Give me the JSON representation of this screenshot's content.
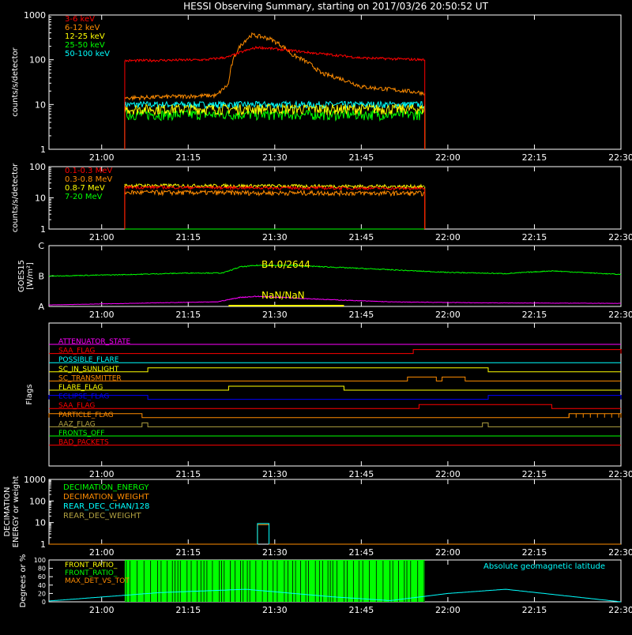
{
  "title": "HESSI Observing Summary, starting on 2017/03/26 20:50:52 UT",
  "colors": {
    "red": "#ff0000",
    "orange": "#ff8c00",
    "yellow": "#ffff00",
    "green": "#00ff00",
    "cyan": "#00ffff",
    "magenta": "#ff00ff",
    "blue": "#0000ff",
    "olive": "#b0a040",
    "white": "#ffffff"
  },
  "time_axis": {
    "tick_labels": [
      "21:00",
      "21:15",
      "21:30",
      "21:45",
      "22:00",
      "22:15",
      "22:30"
    ],
    "start": "20:50:52",
    "end": "22:30"
  },
  "chart_data": [
    {
      "id": "panel1",
      "type": "line",
      "scale": "log",
      "ylabel": "counts/s/detector",
      "yticks": [
        "1",
        "10",
        "100",
        "1000"
      ],
      "ylim": [
        1,
        1000
      ],
      "data_start": "21:04",
      "data_end": "21:56",
      "legend": [
        {
          "label": "3-6 keV",
          "color": "red"
        },
        {
          "label": "6-12 keV",
          "color": "orange"
        },
        {
          "label": "12-25 keV",
          "color": "yellow"
        },
        {
          "label": "25-50 keV",
          "color": "green"
        },
        {
          "label": "50-100 keV",
          "color": "cyan"
        }
      ],
      "series": [
        {
          "name": "3-6 keV",
          "color": "red",
          "x": [
            "21:04",
            "21:18",
            "21:22",
            "21:27",
            "21:31",
            "21:37",
            "21:45",
            "21:56"
          ],
          "values": [
            95,
            100,
            115,
            190,
            170,
            140,
            110,
            100
          ],
          "noise": 0.03
        },
        {
          "name": "6-12 keV",
          "color": "orange",
          "x": [
            "21:04",
            "21:20",
            "21:22",
            "21:24",
            "21:26",
            "21:29",
            "21:33",
            "21:38",
            "21:45",
            "21:56"
          ],
          "values": [
            14,
            16,
            28,
            200,
            360,
            300,
            130,
            50,
            25,
            18
          ],
          "noise": 0.05
        },
        {
          "name": "12-25 keV",
          "color": "yellow",
          "x": [
            "21:04",
            "21:56"
          ],
          "values": [
            8,
            8
          ],
          "noise": 0.12
        },
        {
          "name": "25-50 keV",
          "color": "green",
          "x": [
            "21:04",
            "21:56"
          ],
          "values": [
            6,
            6
          ],
          "noise": 0.12
        },
        {
          "name": "50-100 keV",
          "color": "cyan",
          "x": [
            "21:04",
            "21:56"
          ],
          "values": [
            10,
            10
          ],
          "noise": 0.08
        }
      ]
    },
    {
      "id": "panel2",
      "type": "line",
      "scale": "log",
      "ylabel": "counts/s/detector",
      "yticks": [
        "1",
        "10",
        "100"
      ],
      "ylim": [
        1,
        100
      ],
      "data_start": "21:04",
      "data_end": "21:56",
      "legend": [
        {
          "label": "0.1-0.3 MeV",
          "color": "red"
        },
        {
          "label": "0.3-0.8 MeV",
          "color": "orange"
        },
        {
          "label": "0.8-7 MeV",
          "color": "yellow"
        },
        {
          "label": "7-20 MeV",
          "color": "green"
        }
      ],
      "series": [
        {
          "name": "0.1-0.3 MeV",
          "color": "red",
          "x": [
            "21:04",
            "21:56"
          ],
          "values": [
            22,
            20
          ],
          "noise": 0.05
        },
        {
          "name": "0.3-0.8 MeV",
          "color": "orange",
          "x": [
            "21:04",
            "21:56"
          ],
          "values": [
            15,
            14
          ],
          "noise": 0.08
        },
        {
          "name": "0.8-7 MeV",
          "color": "yellow",
          "x": [
            "21:04",
            "21:56"
          ],
          "values": [
            25,
            23
          ],
          "noise": 0.06
        },
        {
          "name": "7-20 MeV",
          "color": "green",
          "x": [
            "21:04",
            "21:56"
          ],
          "values": [
            1,
            1
          ],
          "noise": 0
        }
      ]
    },
    {
      "id": "panel3",
      "type": "line",
      "ylabel": "GOES15 [W/m²]",
      "ylabel_lines": [
        "GOES15",
        "[W/m²]"
      ],
      "yticks": [
        "A",
        "B",
        "C"
      ],
      "annotations": [
        "B4.0/2644",
        "NaN/NaN"
      ],
      "series": [
        {
          "name": "long",
          "color": "green",
          "x": [
            "20:50:52",
            "21:05",
            "21:15",
            "21:21",
            "21:24",
            "21:27",
            "21:33",
            "21:45",
            "22:00",
            "22:10",
            "22:18",
            "22:25",
            "22:30"
          ],
          "values": [
            1.0,
            1.05,
            1.1,
            1.1,
            1.3,
            1.35,
            1.35,
            1.25,
            1.12,
            1.08,
            1.17,
            1.1,
            1.05
          ],
          "noise": 0.006
        },
        {
          "name": "short",
          "color": "magenta",
          "x": [
            "20:50:52",
            "21:10",
            "21:20",
            "21:24",
            "21:27",
            "21:31",
            "21:40",
            "21:50",
            "22:05",
            "22:30"
          ],
          "values": [
            0.05,
            0.12,
            0.15,
            0.3,
            0.33,
            0.3,
            0.22,
            0.15,
            0.12,
            0.1
          ],
          "noise": 0.025
        }
      ],
      "bar_segment": {
        "color": "yellow",
        "x": [
          "21:22",
          "21:42"
        ]
      }
    },
    {
      "id": "panel4",
      "type": "flags",
      "ylabel": "Flags",
      "flags": [
        {
          "name": "ATTENUATOR_STATE",
          "color": "magenta",
          "on": []
        },
        {
          "name": "SAA_FLAG",
          "color": "red",
          "on": [
            [
              "21:54",
              "22:30"
            ]
          ]
        },
        {
          "name": "POSSIBLE_FLARE",
          "color": "cyan",
          "on": []
        },
        {
          "name": "SC_IN_SUNLIGHT",
          "color": "yellow",
          "on": [
            [
              "21:08",
              "22:07"
            ]
          ]
        },
        {
          "name": "SC_TRANSMITTER",
          "color": "orange",
          "on": [
            [
              "21:53",
              "21:58"
            ],
            [
              "21:59",
              "22:03"
            ]
          ]
        },
        {
          "name": "FLARE_FLAG",
          "color": "yellow",
          "on": [
            [
              "21:22",
              "21:42"
            ]
          ]
        },
        {
          "name": "ECLIPSE_FLAG",
          "color": "blue",
          "on": [
            [
              "20:50:52",
              "21:08"
            ],
            [
              "22:07",
              "22:30"
            ]
          ]
        },
        {
          "name": "SAA_FLAG",
          "color": "red",
          "on": [
            [
              "21:55",
              "22:18"
            ]
          ]
        },
        {
          "name": "PARTICLE_FLAG",
          "color": "orange",
          "on": [
            [
              "20:50:52",
              "21:07"
            ],
            [
              "22:21",
              "22:30"
            ]
          ]
        },
        {
          "name": "AAZ_FLAG",
          "color": "olive",
          "on": [
            [
              "21:07",
              "21:08"
            ],
            [
              "22:06",
              "22:07"
            ]
          ]
        },
        {
          "name": "FRONTS_OFF",
          "color": "green",
          "on": []
        },
        {
          "name": "BAD_PACKETS",
          "color": "red",
          "on": []
        }
      ]
    },
    {
      "id": "panel5",
      "type": "line",
      "scale": "log",
      "ylabel_lines": [
        "DECIMATION",
        "ENERGY or weight"
      ],
      "yticks": [
        "1",
        "10",
        "100",
        "1000"
      ],
      "ylim": [
        1,
        1000
      ],
      "legend": [
        {
          "label": "DECIMATION_ENERGY",
          "color": "green"
        },
        {
          "label": "DECIMATION_WEIGHT",
          "color": "orange"
        },
        {
          "label": "REAR_DEC_CHAN/128",
          "color": "cyan"
        },
        {
          "label": "REAR_DEC_WEIGHT",
          "color": "olive"
        }
      ],
      "series": [
        {
          "name": "DECIMATION_WEIGHT",
          "color": "orange",
          "x": [
            "20:50:52",
            "21:27",
            "21:27",
            "21:29",
            "21:29",
            "22:30"
          ],
          "values": [
            1,
            1,
            8,
            8,
            1,
            1
          ],
          "noise": 0
        },
        {
          "name": "REAR_DEC_CHAN/128",
          "color": "cyan",
          "x": [
            "21:27",
            "21:27",
            "21:29",
            "21:29"
          ],
          "values": [
            1,
            9,
            9,
            1
          ],
          "noise": 0
        }
      ]
    },
    {
      "id": "panel6",
      "type": "area",
      "ylabel": "Degrees or %",
      "yticks": [
        "0",
        "20",
        "40",
        "60",
        "80",
        "100"
      ],
      "ylim": [
        0,
        100
      ],
      "legend": [
        {
          "label": "FRONT_RATIO_",
          "color": "yellow"
        },
        {
          "label": "FRONT_RATIO_",
          "color": "green"
        },
        {
          "label": "MAX_DET_VS_TOT",
          "color": "orange"
        }
      ],
      "right_label": "Absolute geomagnetic latitude",
      "fill": {
        "color": "green",
        "x": [
          "21:04",
          "21:56"
        ],
        "value": 100
      },
      "geomag": {
        "color": "cyan",
        "x": [
          "20:50:52",
          "21:10",
          "21:25",
          "21:40",
          "21:50",
          "22:00",
          "22:10",
          "22:20",
          "22:30"
        ],
        "values": [
          2,
          22,
          30,
          12,
          3,
          20,
          30,
          15,
          0
        ]
      }
    }
  ]
}
